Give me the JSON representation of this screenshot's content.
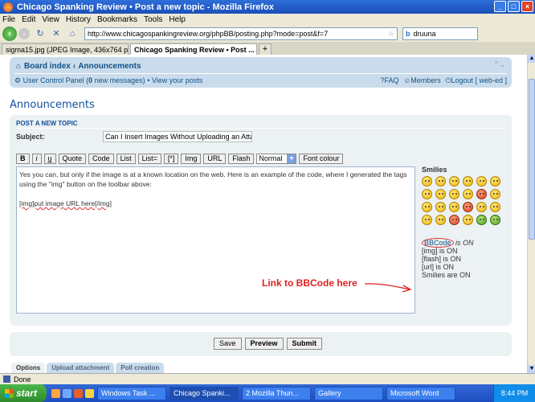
{
  "window": {
    "title": "Chicago Spanking Review • Post a new topic - Mozilla Firefox"
  },
  "menu": [
    "File",
    "Edit",
    "View",
    "History",
    "Bookmarks",
    "Tools",
    "Help"
  ],
  "address": {
    "url": "http://www.chicagospankingreview.org/phpBB/posting.php?mode=post&f=7"
  },
  "search": {
    "value": "druuna"
  },
  "tabs": [
    {
      "label": "sigma15.jpg (JPEG Image, 436x764 pix...",
      "active": false
    },
    {
      "label": "Chicago Spanking Review • Post ...",
      "active": true
    }
  ],
  "forum_nav": {
    "board_index": "Board index",
    "separator": "‹",
    "crumb": "Announcements",
    "ucp": "User Control Panel (",
    "new_messages_count": "0",
    "new_messages_suffix": " new messages)",
    "view_posts": "• View your posts",
    "faq": "FAQ",
    "members": "Members",
    "logout": "Logout [ web-ed ]"
  },
  "page": {
    "heading": "Announcements",
    "panel_head": "POST A NEW TOPIC",
    "subject_label": "Subject:",
    "subject_value": "Can I Insert Images Without Uploading an Attach"
  },
  "toolbar": {
    "buttons": [
      "B",
      "i",
      "u",
      "Quote",
      "Code",
      "List",
      "List=",
      "[*]",
      "Img",
      "URL",
      "Flash"
    ],
    "font_size": "Normal",
    "font_colour": "Font colour"
  },
  "message": {
    "para1": "Yes you can, but only if the image is at a known location on the web.  Here is an example of the code, where I generated the tags using the \"img\" button on the toolbar above:",
    "para2": "[img]put image URL here[/img]"
  },
  "smilies": {
    "title": "Smilies"
  },
  "bbcode_status": {
    "bbcode_link": "BBCode",
    "bbcode_suffix": " is ON",
    "img": "[img] is ON",
    "flash": "[flash] is ON",
    "url": "[url] is ON",
    "smilies": "Smilies are ON"
  },
  "annotation": {
    "text": "Link to BBCode here"
  },
  "actions": {
    "save": "Save",
    "preview": "Preview",
    "submit": "Submit"
  },
  "bottom_tabs": [
    "Options",
    "Upload attachment",
    "Poll creation"
  ],
  "statusbar": {
    "text": "Done"
  },
  "taskbar": {
    "start": "start",
    "items": [
      "Windows Task ...",
      "Chicago Spanki...",
      "2 Mozilla Thun...",
      "Gallery",
      "Microsoft Word"
    ],
    "clock": "8:44 PM"
  }
}
